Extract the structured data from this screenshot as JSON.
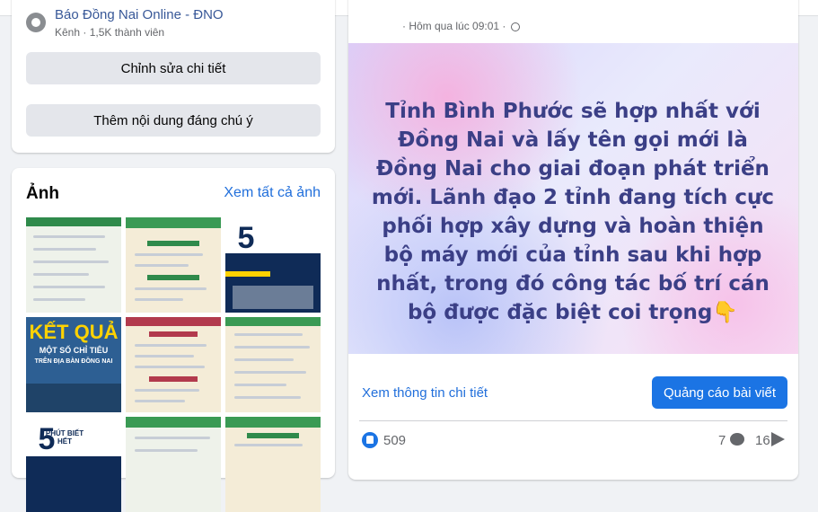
{
  "group": {
    "name": "Báo Đồng Nai Online - ĐNO",
    "meta": "Kênh · 1,5K thành viên",
    "edit_button": "Chỉnh sửa chi tiết",
    "featured_button": "Thêm nội dung đáng chú ý"
  },
  "photos": {
    "title": "Ảnh",
    "see_all": "Xem tất cả ảnh",
    "thumb_texts": {
      "phut": "5",
      "phut_label": "PHÚT BIẾT HẾT",
      "ket_qua": "KẾT QUẢ",
      "chi_tieu": "MỘT SỐ CHỈ TIÊU",
      "dia_ban": "TRÊN ĐỊA BÀN ĐỒNG NAI"
    }
  },
  "post": {
    "time": "· Hôm qua lúc 09:01 ·",
    "text": "Tỉnh Bình Phước sẽ hợp nhất với Đồng Nai và lấy tên gọi mới là Đồng Nai cho giai đoạn phát triển mới. Lãnh đạo 2 tỉnh đang tích cực phối hợp xây dựng và hoàn thiện bộ máy mới của tỉnh sau khi hợp nhất, trong đó công tác bố trí cán bộ được đặc biệt coi trọng",
    "emoji": "👇",
    "detail_link": "Xem thông tin chi tiết",
    "boost_button": "Quảng cáo bài viết",
    "likes": "509",
    "comments": "7",
    "shares": "16"
  },
  "colors": {
    "link": "#216fdb",
    "primary_button": "#1b74e4",
    "post_text": "#3b3f86"
  }
}
